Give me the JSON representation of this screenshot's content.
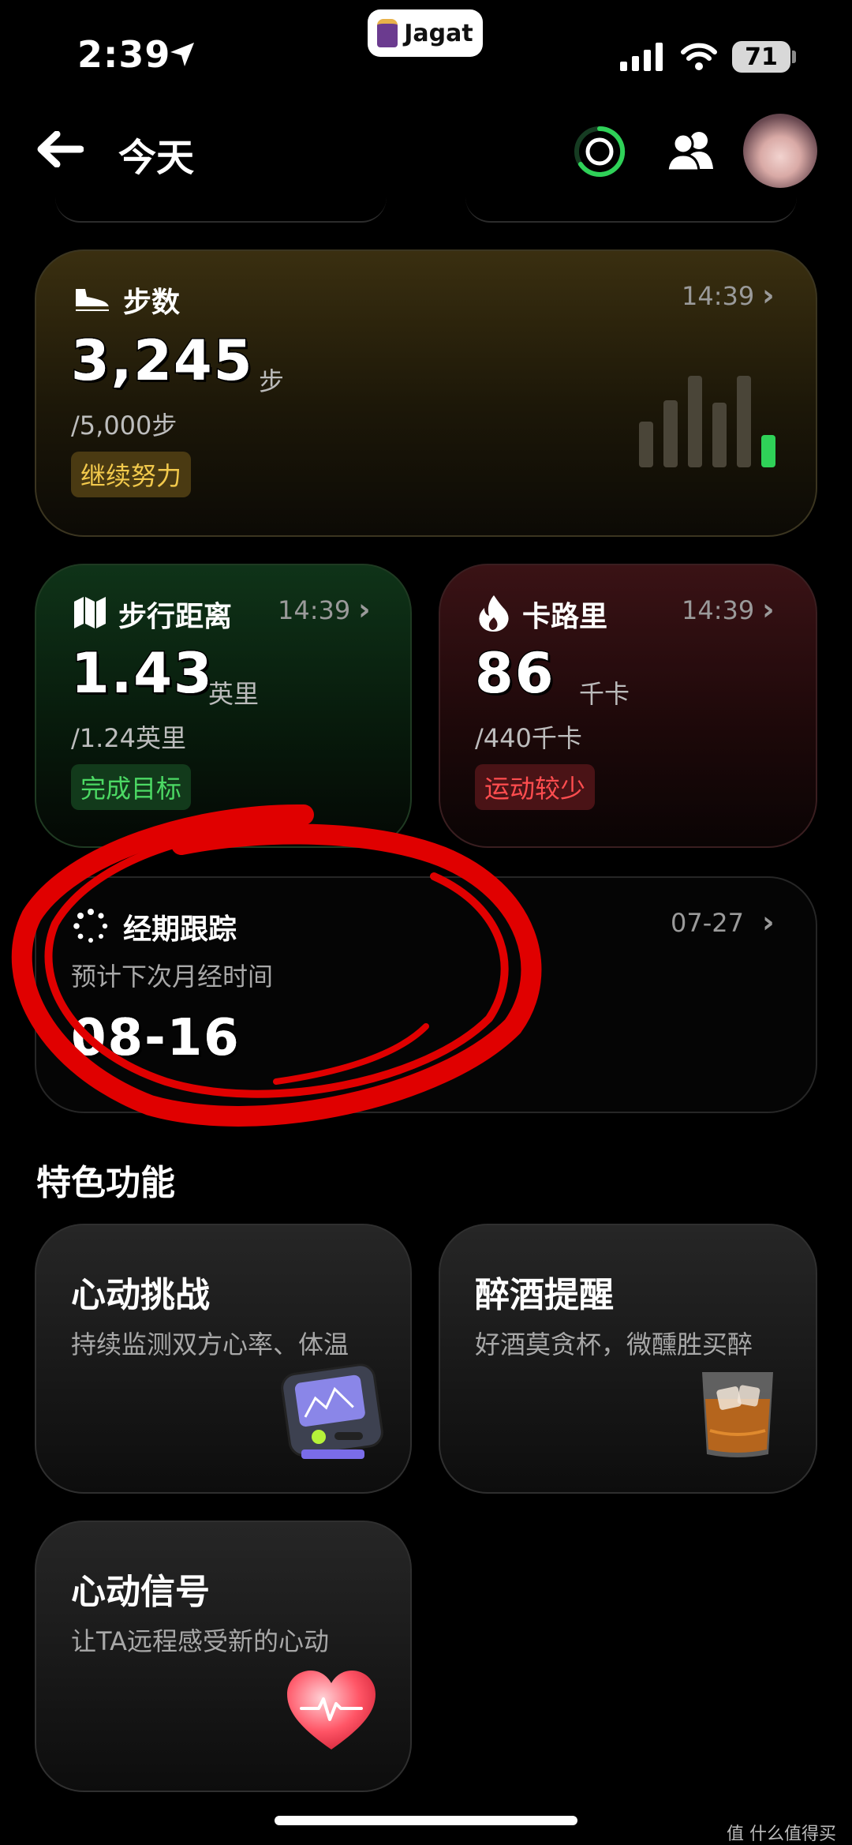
{
  "status_bar": {
    "time": "2:39",
    "app_pill": "Jagat",
    "battery": "71"
  },
  "header": {
    "title": "今天"
  },
  "steps": {
    "label": "步数",
    "time": "14:39",
    "value": "3,245",
    "unit": "步",
    "goal": "/5,000步",
    "badge": "继续努力",
    "bars": [
      0.5,
      0.73,
      1.0,
      0.71,
      1.0,
      0.35
    ]
  },
  "distance": {
    "label": "步行距离",
    "time": "14:39",
    "value": "1.43",
    "unit": "英里",
    "goal": "/1.24英里",
    "badge": "完成目标"
  },
  "calories": {
    "label": "卡路里",
    "time": "14:39",
    "value": "86",
    "unit": "千卡",
    "goal": "/440千卡",
    "badge": "运动较少"
  },
  "period": {
    "label": "经期跟踪",
    "date": "07-27",
    "subtitle": "预计下次月经时间",
    "value": "08-16"
  },
  "features": {
    "title": "特色功能",
    "items": [
      {
        "title": "心动挑战",
        "subtitle": "持续监测双方心率、体温"
      },
      {
        "title": "醉酒提醒",
        "subtitle": "好酒莫贪杯，微醺胜买醉"
      },
      {
        "title": "心动信号",
        "subtitle": "让TA远程感受新的心动"
      }
    ]
  },
  "watermark": "值 什么值得买",
  "colors": {
    "accent_green": "#2fd158",
    "badge_yellow": "#f2c94c",
    "badge_red": "#ff4d4f",
    "annotation_red": "#e00000"
  }
}
